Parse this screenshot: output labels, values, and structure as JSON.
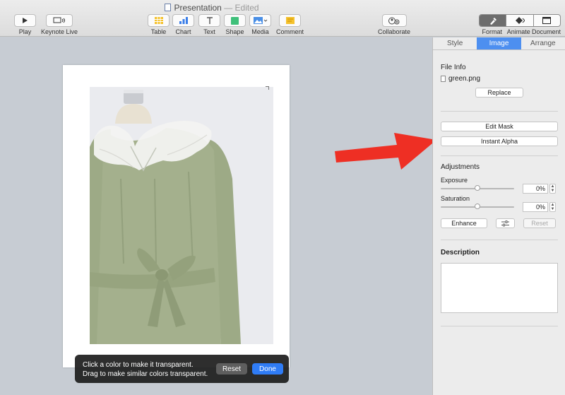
{
  "window": {
    "title": "Presentation",
    "edited": "— Edited"
  },
  "toolbar": {
    "play": "Play",
    "keynote_live": "Keynote Live",
    "table": "Table",
    "chart": "Chart",
    "text": "Text",
    "shape": "Shape",
    "media": "Media",
    "comment": "Comment",
    "collaborate": "Collaborate",
    "format": "Format",
    "animate": "Animate",
    "document": "Document"
  },
  "inspector": {
    "tabs": [
      "Style",
      "Image",
      "Arrange"
    ],
    "active_tab": "Image",
    "file_info_title": "File Info",
    "file_name": "green.png",
    "replace": "Replace",
    "edit_mask": "Edit Mask",
    "instant_alpha": "Instant Alpha",
    "adjustments_title": "Adjustments",
    "exposure_label": "Exposure",
    "exposure_value": "0%",
    "exposure_level": 0.5,
    "saturation_label": "Saturation",
    "saturation_value": "0%",
    "saturation_level": 0.5,
    "enhance": "Enhance",
    "reset": "Reset",
    "description_title": "Description"
  },
  "alpha_hud": {
    "line1": "Click a color to make it transparent.",
    "line2": "Drag to make similar colors transparent.",
    "reset": "Reset",
    "done": "Done"
  },
  "colors": {
    "accent": "#4d8ff0",
    "done_button": "#2f7cf6",
    "annotation_arrow": "#ee2f24",
    "dress_green": "#a4b08d"
  },
  "icons": [
    "play-icon",
    "keynote-live-icon",
    "table-icon",
    "chart-icon",
    "text-icon",
    "shape-icon",
    "media-icon",
    "comment-icon",
    "collaborate-icon",
    "format-icon",
    "animate-icon",
    "document-icon",
    "file-icon",
    "image-adjust-icon"
  ]
}
